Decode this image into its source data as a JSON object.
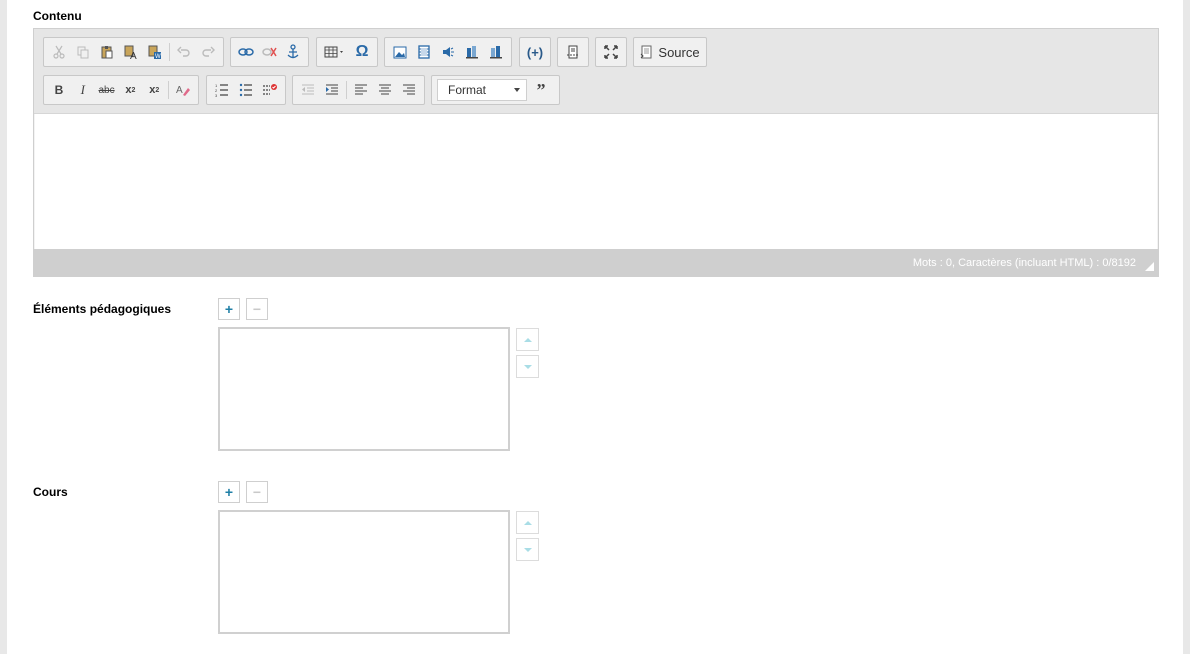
{
  "fields": {
    "contenu_label": "Contenu",
    "elements_label": "Éléments pédagogiques",
    "cours_label": "Cours"
  },
  "editor": {
    "toolbar_row1": {
      "clipboard": [
        "cut-icon",
        "copy-icon",
        "paste-icon",
        "paste-text-icon",
        "paste-word-icon",
        "undo-icon",
        "redo-icon"
      ],
      "links": [
        "link-icon",
        "unlink-icon",
        "anchor-icon"
      ],
      "insert": [
        "table-icon",
        "special-char-icon"
      ],
      "media": [
        "image-icon",
        "video-icon",
        "audio-icon",
        "document-icon",
        "resource-icon"
      ],
      "source_label": "Source"
    },
    "toolbar_row2": {
      "basic": [
        "bold-icon",
        "italic-icon",
        "strike-icon",
        "subscript-icon",
        "superscript-icon",
        "remove-format-icon"
      ],
      "lists": [
        "numbered-list-icon",
        "bulleted-list-icon",
        "checklist-icon"
      ],
      "indent_align": [
        "outdent-icon",
        "indent-icon",
        "align-left-icon",
        "align-center-icon",
        "align-right-icon"
      ],
      "format_label": "Format",
      "blockquote": "blockquote-icon"
    },
    "status": "Mots : 0, Caractères (incluant HTML) : 0/8192"
  },
  "colors": {
    "accent": "#1f7fa6",
    "toolbar_bg": "#e6e6e6",
    "status_bg": "#cfcfcf",
    "arrow": "#a9dde6"
  },
  "buttons": {
    "plus": "+",
    "minus": "−"
  }
}
